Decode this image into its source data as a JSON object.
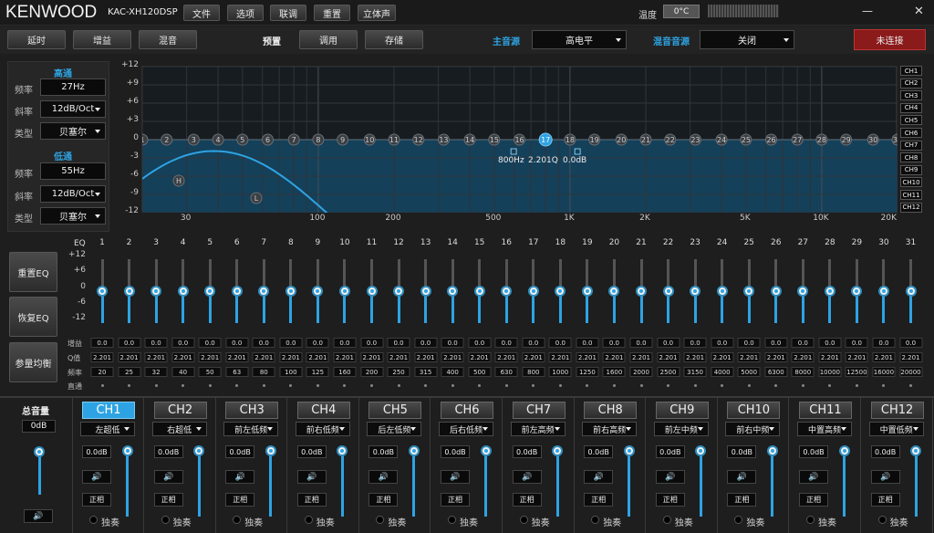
{
  "app": {
    "brand": "KENWOOD",
    "model": "KAC-XH120DSP"
  },
  "menu": [
    "文件",
    "选项",
    "联调",
    "重置",
    "立体声"
  ],
  "temperature": {
    "label": "温度",
    "value": "0°C"
  },
  "window_controls": {
    "minimize": "—",
    "close": "✕"
  },
  "toolbar": {
    "delay": "延时",
    "gain": "增益",
    "mix": "混音",
    "preset_label": "预置",
    "recall": "调用",
    "save": "存储",
    "main_source_label": "主音源",
    "main_source_value": "高电平",
    "mix_source_label": "混音音源",
    "mix_source_value": "关闭",
    "connect_status": "未连接"
  },
  "filter": {
    "hp_title": "高通",
    "lp_title": "低通",
    "freq_label": "频率",
    "slope_label": "斜率",
    "type_label": "类型",
    "hp_freq": "27Hz",
    "hp_slope": "12dB/Oct",
    "hp_type": "贝塞尔",
    "lp_freq": "55Hz",
    "lp_slope": "12dB/Oct",
    "lp_type": "贝塞尔"
  },
  "graph": {
    "y_ticks": [
      "+12",
      "+9",
      "+6",
      "+3",
      "0",
      "-3",
      "-6",
      "-9",
      "-12"
    ],
    "x_ticks": [
      "30",
      "100",
      "200",
      "500",
      "1K",
      "2K",
      "5K",
      "10K",
      "20K"
    ],
    "selected_point": "17",
    "readout_freq": "800Hz",
    "readout_q": "2.201Q",
    "readout_gain": "0.0dB",
    "hp_marker": "H",
    "lp_marker": "L"
  },
  "graph_channels": [
    "CH1",
    "CH2",
    "CH3",
    "CH4",
    "CH5",
    "CH6",
    "CH7",
    "CH8",
    "CH9",
    "CH10",
    "CH11",
    "CH12"
  ],
  "side_buttons": {
    "reset_eq": "重置EQ",
    "restore_eq": "恢复EQ",
    "param_eq": "参量均衡"
  },
  "eq": {
    "label": "EQ",
    "scale": [
      "+12",
      "+6",
      "0",
      "-6",
      "-12"
    ],
    "row_gain": "增益",
    "row_q": "Q值",
    "row_freq": "频率",
    "row_bypass": "直通",
    "bands": [
      "1",
      "2",
      "3",
      "4",
      "5",
      "6",
      "7",
      "8",
      "9",
      "10",
      "11",
      "12",
      "13",
      "14",
      "15",
      "16",
      "17",
      "18",
      "19",
      "20",
      "21",
      "22",
      "23",
      "24",
      "25",
      "26",
      "27",
      "28",
      "29",
      "30",
      "31"
    ],
    "gains": [
      "0.0",
      "0.0",
      "0.0",
      "0.0",
      "0.0",
      "0.0",
      "0.0",
      "0.0",
      "0.0",
      "0.0",
      "0.0",
      "0.0",
      "0.0",
      "0.0",
      "0.0",
      "0.0",
      "0.0",
      "0.0",
      "0.0",
      "0.0",
      "0.0",
      "0.0",
      "0.0",
      "0.0",
      "0.0",
      "0.0",
      "0.0",
      "0.0",
      "0.0",
      "0.0",
      "0.0"
    ],
    "q": [
      "2.201",
      "2.201",
      "2.201",
      "2.201",
      "2.201",
      "2.201",
      "2.201",
      "2.201",
      "2.201",
      "2.201",
      "2.201",
      "2.201",
      "2.201",
      "2.201",
      "2.201",
      "2.201",
      "2.201",
      "2.201",
      "2.201",
      "2.201",
      "2.201",
      "2.201",
      "2.201",
      "2.201",
      "2.201",
      "2.201",
      "2.201",
      "2.201",
      "2.201",
      "2.201",
      "2.201"
    ],
    "freqs": [
      "20",
      "25",
      "32",
      "40",
      "50",
      "63",
      "80",
      "100",
      "125",
      "160",
      "200",
      "250",
      "315",
      "400",
      "500",
      "630",
      "800",
      "1000",
      "1250",
      "1600",
      "2000",
      "2500",
      "3150",
      "4000",
      "5000",
      "6300",
      "8000",
      "10000",
      "12500",
      "16000",
      "20000"
    ]
  },
  "master": {
    "label": "总音量",
    "value": "0dB"
  },
  "channels": [
    {
      "name": "CH1",
      "assign": "左超低",
      "level": "0.0dB",
      "phase": "正相",
      "solo": "独奏"
    },
    {
      "name": "CH2",
      "assign": "右超低",
      "level": "0.0dB",
      "phase": "正相",
      "solo": "独奏"
    },
    {
      "name": "CH3",
      "assign": "前左低频",
      "level": "0.0dB",
      "phase": "正相",
      "solo": "独奏"
    },
    {
      "name": "CH4",
      "assign": "前右低频",
      "level": "0.0dB",
      "phase": "正相",
      "solo": "独奏"
    },
    {
      "name": "CH5",
      "assign": "后左低频",
      "level": "0.0dB",
      "phase": "正相",
      "solo": "独奏"
    },
    {
      "name": "CH6",
      "assign": "后右低频",
      "level": "0.0dB",
      "phase": "正相",
      "solo": "独奏"
    },
    {
      "name": "CH7",
      "assign": "前左高频",
      "level": "0.0dB",
      "phase": "正相",
      "solo": "独奏"
    },
    {
      "name": "CH8",
      "assign": "前右高频",
      "level": "0.0dB",
      "phase": "正相",
      "solo": "独奏"
    },
    {
      "name": "CH9",
      "assign": "前左中频",
      "level": "0.0dB",
      "phase": "正相",
      "solo": "独奏"
    },
    {
      "name": "CH10",
      "assign": "前右中频",
      "level": "0.0dB",
      "phase": "正相",
      "solo": "独奏"
    },
    {
      "name": "CH11",
      "assign": "中置高频",
      "level": "0.0dB",
      "phase": "正相",
      "solo": "独奏"
    },
    {
      "name": "CH12",
      "assign": "中置低频",
      "level": "0.0dB",
      "phase": "正相",
      "solo": "独奏"
    }
  ],
  "colors": {
    "accent": "#2ea3e3",
    "alert": "#8b1a1a",
    "graph_fill": "#14405a"
  }
}
